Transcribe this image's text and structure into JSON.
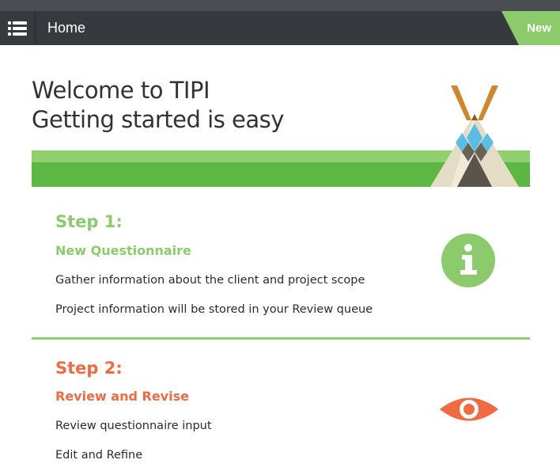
{
  "navbar": {
    "title": "Home",
    "badge_label": "New",
    "menu_icon": "list-menu-icon"
  },
  "welcome": {
    "line1": "Welcome to TIPI",
    "line2": "Getting started is easy"
  },
  "steps": [
    {
      "heading": "Step 1:",
      "title": "New Questionnaire",
      "lines": [
        "Gather information about the client and project scope",
        "Project information will be stored in your Review queue"
      ],
      "icon": "info-icon",
      "color": "#8ccb6b"
    },
    {
      "heading": "Step 2:",
      "title": "Review and Revise",
      "lines": [
        "Review questionnaire input",
        "Edit and Refine"
      ],
      "icon": "eye-icon",
      "color": "#f06a42"
    }
  ],
  "colors": {
    "navbar": "#363a3f",
    "accent_green": "#5cb842",
    "light_green": "#8fcf70",
    "badge": "#8ccb6b",
    "orange": "#f06a42"
  }
}
